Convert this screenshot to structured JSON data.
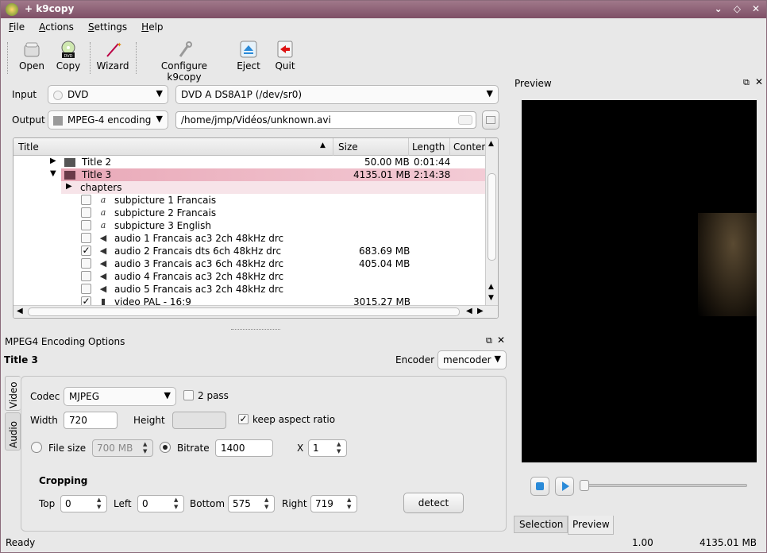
{
  "window": {
    "title": "+ k9copy"
  },
  "menu": [
    "File",
    "Actions",
    "Settings",
    "Help"
  ],
  "toolbar": {
    "open": "Open",
    "copy": "Copy",
    "wizard": "Wizard",
    "configure": "Configure k9copy",
    "eject": "Eject",
    "quit": "Quit"
  },
  "io": {
    "input_label": "Input",
    "input_type": "DVD",
    "input_device": "DVD A  DS8A1P  (/dev/sr0)",
    "output_label": "Output",
    "output_type": "MPEG-4 encoding",
    "output_path": "/home/jmp/Vidéos/unknown.avi"
  },
  "tree": {
    "headers": {
      "title": "Title",
      "size": "Size",
      "length": "Length",
      "content": "Conten"
    },
    "rows": [
      {
        "label": "Title 2",
        "size": "50.00 MB",
        "length": "0:01:44"
      },
      {
        "label": "Title 3",
        "size": "4135.01 MB",
        "length": "2:14:38"
      },
      {
        "label": "chapters",
        "size": "",
        "length": ""
      },
      {
        "label": "subpicture 1 Francais",
        "size": "",
        "length": ""
      },
      {
        "label": "subpicture 2 Francais",
        "size": "",
        "length": ""
      },
      {
        "label": "subpicture 3 English",
        "size": "",
        "length": ""
      },
      {
        "label": "audio 1 Francais ac3 2ch 48kHz drc",
        "size": "",
        "length": ""
      },
      {
        "label": "audio 2 Francais dts 6ch 48kHz drc",
        "size": "683.69 MB",
        "length": ""
      },
      {
        "label": "audio 3 Francais ac3 6ch 48kHz drc",
        "size": "405.04 MB",
        "length": ""
      },
      {
        "label": "audio 4 Francais ac3 2ch 48kHz drc",
        "size": "",
        "length": ""
      },
      {
        "label": "audio 5 Francais ac3 2ch 48kHz drc",
        "size": "",
        "length": ""
      },
      {
        "label": "video PAL  - 16:9",
        "size": "3015.27 MB",
        "length": ""
      }
    ]
  },
  "encoding": {
    "panel_title": "MPEG4 Encoding Options",
    "title": "Title 3",
    "encoder_label": "Encoder",
    "encoder": "mencoder",
    "tabs": {
      "video": "Video",
      "audio": "Audio"
    },
    "codec_label": "Codec",
    "codec": "MJPEG",
    "two_pass": "2 pass",
    "width_label": "Width",
    "width": "720",
    "height_label": "Height",
    "height": "",
    "keep_aspect": "keep aspect ratio",
    "filesize_label": "File size",
    "filesize": "700 MB",
    "bitrate_label": "Bitrate",
    "bitrate": "1400",
    "x_label": "X",
    "x": "1",
    "cropping": "Cropping",
    "top_label": "Top",
    "top": "0",
    "left_label": "Left",
    "left": "0",
    "bottom_label": "Bottom",
    "bottom": "575",
    "right_label": "Right",
    "right": "719",
    "detect": "detect"
  },
  "preview": {
    "title": "Preview",
    "tab_selection": "Selection",
    "tab_preview": "Preview"
  },
  "status": {
    "text": "Ready",
    "ratio": "1.00",
    "size": "4135.01 MB"
  }
}
